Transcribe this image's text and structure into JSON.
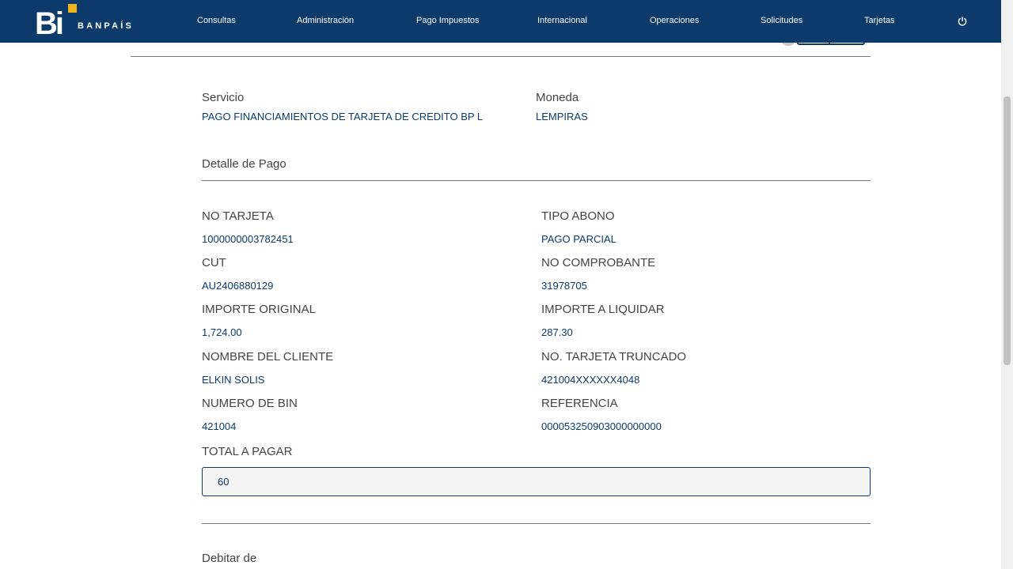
{
  "header": {
    "logo_mark": "Bi",
    "logo_text": "BANPAÍS",
    "nav": [
      "Consultas",
      "Administración",
      "Pago Impuestos",
      "Internacional",
      "Operaciones",
      "Solicitudes",
      "Tarjetas"
    ],
    "power_icon": "power-icon",
    "brand_color": "#0b3a6b",
    "accent_color": "#f2b21b"
  },
  "service": {
    "servicio_label": "Servicio",
    "servicio_value": "PAGO FINANCIAMIENTOS DE TARJETA DE CREDITO BP L",
    "moneda_label": "Moneda",
    "moneda_value": "LEMPIRAS"
  },
  "detalle": {
    "title": "Detalle de Pago",
    "fields": [
      {
        "label": "NO TARJETA",
        "value": "1000000003782451"
      },
      {
        "label": "TIPO ABONO",
        "value": "PAGO PARCIAL"
      },
      {
        "label": "CUT",
        "value": "AU2406880129"
      },
      {
        "label": "NO COMPROBANTE",
        "value": "31978705"
      },
      {
        "label": "IMPORTE ORIGINAL",
        "value": "1,724.00"
      },
      {
        "label": "IMPORTE A LIQUIDAR",
        "value": "287.30"
      },
      {
        "label": "NOMBRE DEL CLIENTE",
        "value": "ELKIN SOLIS"
      },
      {
        "label": "NO. TARJETA TRUNCADO",
        "value": "421004XXXXXX4048"
      },
      {
        "label": "NUMERO DE BIN",
        "value": "421004"
      },
      {
        "label": "REFERENCIA",
        "value": "000053250903000000000"
      }
    ],
    "total_label": "TOTAL A PAGAR",
    "total_value": "60"
  },
  "debitar": {
    "label": "Debitar de"
  }
}
